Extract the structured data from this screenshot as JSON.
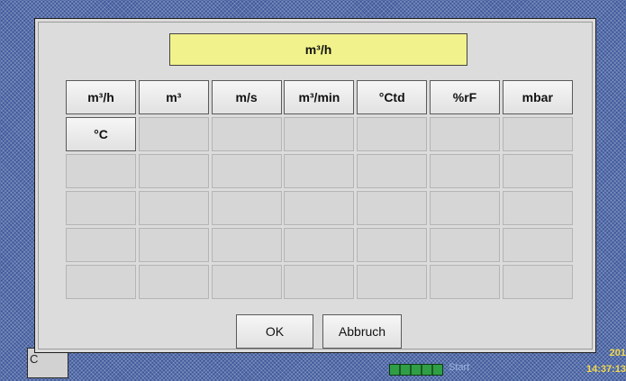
{
  "background": {
    "tab_label": "C",
    "status_text": "Start",
    "clock_date": "201",
    "clock_time": "14:37:13"
  },
  "dialog": {
    "selected_unit": "m³/h",
    "units": [
      "m³/h",
      "m³",
      "m/s",
      "m³/min",
      "°Ctd",
      "%rF",
      "mbar",
      "°C"
    ],
    "empty_cells": 34,
    "ok_label": "OK",
    "cancel_label": "Abbruch"
  },
  "colors": {
    "title_field": "#f2f28c",
    "dialog_bg": "#dcdcdc",
    "desktop_bg": "#3f5a9c",
    "status_green": "#2f9e45",
    "clock_yellow": "#f2d94a"
  }
}
